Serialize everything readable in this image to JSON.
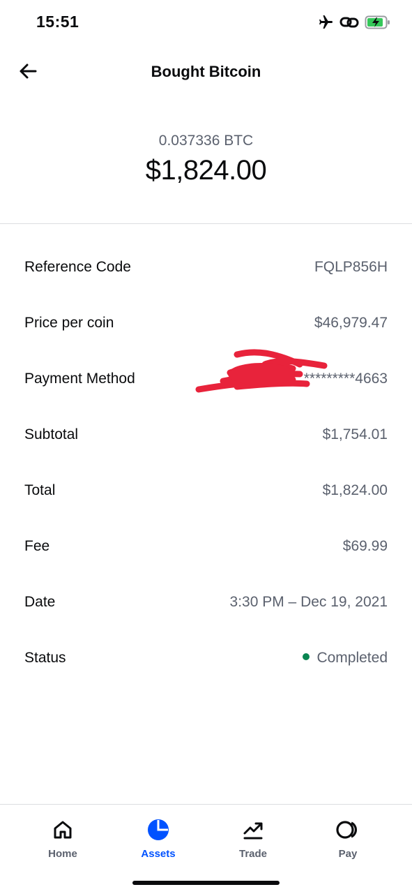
{
  "status_bar": {
    "time": "15:51",
    "icons": [
      "airplane-icon",
      "link-icon",
      "battery-charging-icon"
    ],
    "battery_color": "#34c759"
  },
  "header": {
    "title": "Bought Bitcoin"
  },
  "summary": {
    "crypto_amount": "0.037336 BTC",
    "fiat_amount": "$1,824.00"
  },
  "details": {
    "rows": [
      {
        "label": "Reference Code",
        "value": "FQLP856H"
      },
      {
        "label": "Price per coin",
        "value": "$46,979.47"
      },
      {
        "label": "Payment Method",
        "value": "*********4663"
      },
      {
        "label": "Subtotal",
        "value": "$1,754.01"
      },
      {
        "label": "Total",
        "value": "$1,824.00"
      },
      {
        "label": "Fee",
        "value": "$69.99"
      },
      {
        "label": "Date",
        "value": "3:30 PM – Dec 19, 2021"
      },
      {
        "label": "Status",
        "value": "Completed"
      }
    ],
    "status_color": "#098551"
  },
  "tabs": [
    {
      "label": "Home",
      "icon": "home-icon",
      "active": false
    },
    {
      "label": "Assets",
      "icon": "pie-chart-icon",
      "active": true
    },
    {
      "label": "Trade",
      "icon": "trend-chart-icon",
      "active": false
    },
    {
      "label": "Pay",
      "icon": "pay-icon",
      "active": false
    }
  ],
  "colors": {
    "accent": "#0052ff",
    "text_primary": "#0a0b0d",
    "text_secondary": "#5b616e",
    "redaction": "#e8233b"
  }
}
